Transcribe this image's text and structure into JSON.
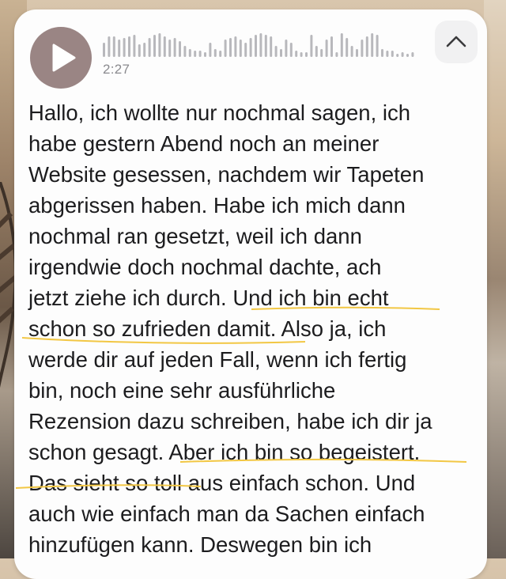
{
  "voice_message": {
    "duration": "2:27",
    "play_icon": "play-icon",
    "collapse_icon": "chevron-up-icon",
    "accent_color": "#9a8584",
    "highlight_color": "#f2c744"
  },
  "transcript": {
    "lines": [
      "Hallo, ich wollte nur nochmal sagen, ich",
      "habe gestern Abend noch an meiner",
      "Website gesessen, nachdem wir Tapeten",
      "abgerissen haben. Habe ich mich dann",
      "nochmal ran gesetzt, weil ich dann",
      "irgendwie doch nochmal dachte, ach",
      "jetzt ziehe ich durch. Und ich bin echt",
      "schon so zufrieden damit. Also ja, ich",
      "werde dir auf jeden Fall, wenn ich fertig",
      "bin, noch eine sehr ausführliche",
      "Rezension dazu schreiben, habe ich dir ja",
      "schon gesagt. Aber ich bin so begeistert.",
      "Das sieht so toll aus einfach schon. Und",
      "auch wie einfach man da Sachen einfach",
      "hinzufügen kann. Deswegen bin ich"
    ]
  }
}
